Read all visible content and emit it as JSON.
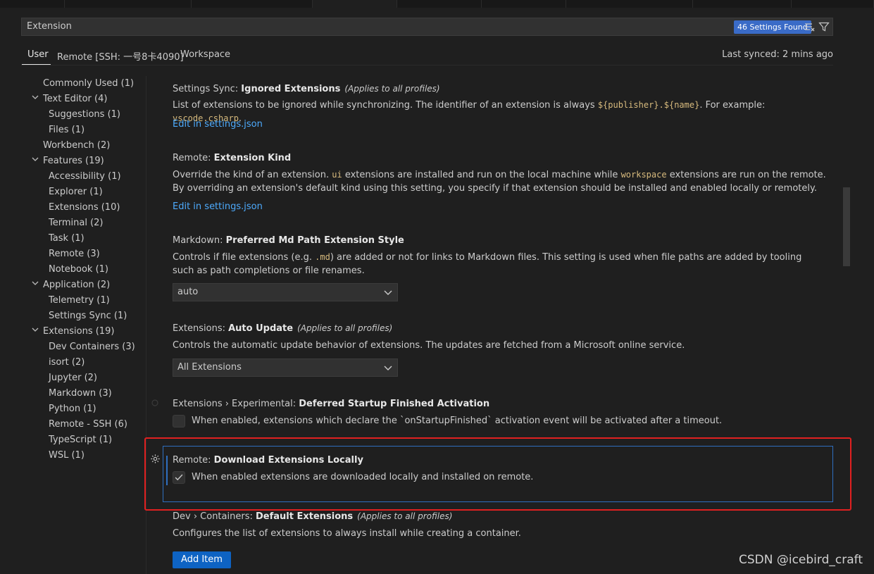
{
  "search": {
    "value": "Extension",
    "results_badge": "46 Settings Found"
  },
  "scope_tabs": [
    {
      "label": "User",
      "active": true
    },
    {
      "label": "Remote [SSH: 一号8卡4090]",
      "active": false
    },
    {
      "label": "Workspace",
      "active": false
    }
  ],
  "last_synced": "Last synced: 2 mins ago",
  "toc": [
    {
      "label": "Commonly Used (1)",
      "level": 0,
      "chevron": false
    },
    {
      "label": "Text Editor (4)",
      "level": 0,
      "chevron": true
    },
    {
      "label": "Suggestions (1)",
      "level": 1,
      "chevron": false
    },
    {
      "label": "Files (1)",
      "level": 1,
      "chevron": false
    },
    {
      "label": "Workbench (2)",
      "level": 0,
      "chevron": false
    },
    {
      "label": "Features (19)",
      "level": 0,
      "chevron": true
    },
    {
      "label": "Accessibility (1)",
      "level": 1,
      "chevron": false
    },
    {
      "label": "Explorer (1)",
      "level": 1,
      "chevron": false
    },
    {
      "label": "Extensions (10)",
      "level": 1,
      "chevron": false
    },
    {
      "label": "Terminal (2)",
      "level": 1,
      "chevron": false
    },
    {
      "label": "Task (1)",
      "level": 1,
      "chevron": false
    },
    {
      "label": "Remote (3)",
      "level": 1,
      "chevron": false
    },
    {
      "label": "Notebook (1)",
      "level": 1,
      "chevron": false
    },
    {
      "label": "Application (2)",
      "level": 0,
      "chevron": true
    },
    {
      "label": "Telemetry (1)",
      "level": 1,
      "chevron": false
    },
    {
      "label": "Settings Sync (1)",
      "level": 1,
      "chevron": false
    },
    {
      "label": "Extensions (19)",
      "level": 0,
      "chevron": true
    },
    {
      "label": "Dev Containers (3)",
      "level": 1,
      "chevron": false
    },
    {
      "label": "isort (2)",
      "level": 1,
      "chevron": false
    },
    {
      "label": "Jupyter (2)",
      "level": 1,
      "chevron": false
    },
    {
      "label": "Markdown (3)",
      "level": 1,
      "chevron": false
    },
    {
      "label": "Python (1)",
      "level": 1,
      "chevron": false
    },
    {
      "label": "Remote - SSH (6)",
      "level": 1,
      "chevron": false
    },
    {
      "label": "TypeScript (1)",
      "level": 1,
      "chevron": false
    },
    {
      "label": "WSL (1)",
      "level": 1,
      "chevron": false
    }
  ],
  "settings": {
    "s1": {
      "category": "Settings Sync: ",
      "name": "Ignored Extensions",
      "applies": "(Applies to all profiles)",
      "desc_a": "List of extensions to be ignored while synchronizing. The identifier of an extension is always ",
      "code_a": "${publisher}.${name}",
      "desc_b": ". For example: ",
      "code_b": "vscode.csharp",
      "desc_c": ".",
      "link": "Edit in settings.json"
    },
    "s2": {
      "category": "Remote: ",
      "name": "Extension Kind",
      "desc_a": "Override the kind of an extension. ",
      "code_a": "ui",
      "desc_b": " extensions are installed and run on the local machine while ",
      "code_b": "workspace",
      "desc_c": " extensions are run on the remote. By overriding an extension's default kind using this setting, you specify if that extension should be installed and enabled locally or remotely.",
      "link": "Edit in settings.json"
    },
    "s3": {
      "category": "Markdown: ",
      "name": "Preferred Md Path Extension Style",
      "desc_a": "Controls if file extensions (e.g. ",
      "code_a": ".md",
      "desc_b": ") are added or not for links to Markdown files. This setting is used when file paths are added by tooling such as path completions or file renames.",
      "value": "auto"
    },
    "s4": {
      "category": "Extensions: ",
      "name": "Auto Update",
      "applies": "(Applies to all profiles)",
      "desc": "Controls the automatic update behavior of extensions. The updates are fetched from a Microsoft online service.",
      "value": "All Extensions"
    },
    "s5": {
      "category": "Extensions › Experimental: ",
      "name": "Deferred Startup Finished Activation",
      "desc": "When enabled, extensions which declare the `onStartupFinished` activation event will be activated after a timeout.",
      "checked": false
    },
    "s6": {
      "category": "Remote: ",
      "name": "Download Extensions Locally",
      "desc": "When enabled extensions are downloaded locally and installed on remote.",
      "checked": true
    },
    "s7": {
      "category": "Dev › Containers: ",
      "name": "Default Extensions",
      "applies": "(Applies to all profiles)",
      "desc": "Configures the list of extensions to always install while creating a container.",
      "button": "Add Item"
    }
  },
  "watermark": "CSDN @icebird_craft",
  "colors": {
    "accent": "#0e63c3",
    "focus_border": "#2f6fbf",
    "highlight": "#e02020",
    "link": "#4daafc"
  }
}
